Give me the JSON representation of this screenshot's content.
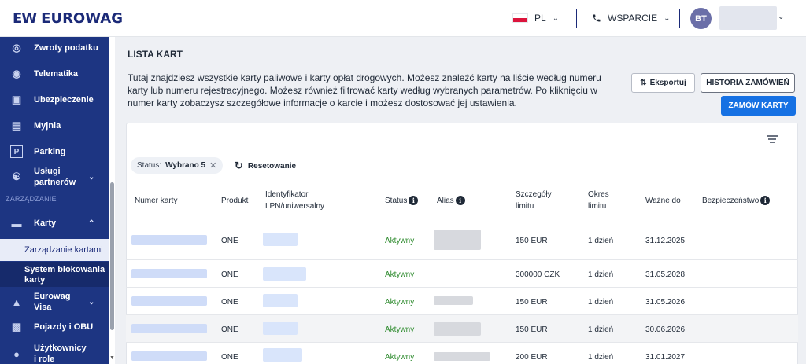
{
  "header": {
    "logo_mark": "EW",
    "logo_text": "EUROWAG",
    "language": "PL",
    "support_label": "WSPARCIE",
    "user_initials": "BT"
  },
  "sidebar": {
    "items": [
      {
        "label": "Zwroty podatku",
        "icon": "tax-refund-icon"
      },
      {
        "label": "Telematika",
        "icon": "telematics-icon"
      },
      {
        "label": "Ubezpieczenie",
        "icon": "insurance-icon"
      },
      {
        "label": "Myjnia",
        "icon": "carwash-icon"
      },
      {
        "label": "Parking",
        "icon": "parking-icon"
      },
      {
        "label": "Usługi partnerów",
        "icon": "partners-icon"
      }
    ],
    "section_label": "ZARZĄDZANIE",
    "karty_label": "Karty",
    "sub_active": "Zarządzanie kartami",
    "sub_item": "System blokowania karty",
    "more_items": [
      {
        "label": "Eurowag Visa",
        "icon": "visa-icon"
      },
      {
        "label": "Pojazdy i OBU",
        "icon": "vehicle-icon"
      },
      {
        "label": "Użytkownicy i role",
        "icon": "users-icon"
      }
    ]
  },
  "main": {
    "title": "LISTA KART",
    "description": "Tutaj znajdziesz wszystkie karty paliwowe i karty opłat drogowych. Możesz znaleźć karty na liście według numeru karty lub numeru rejestracyjnego. Możesz również filtrować karty według wybranych parametrów. Po kliknięciu w numer karty zobaczysz szczegółowe informacje o karcie i możesz dostosować jej ustawienia.",
    "export_label": "Eksportuj",
    "history_label": "HISTORIA ZAMÓWIEŃ",
    "order_label": "ZAMÓW KARTY",
    "filter_chip_prefix": "Status:",
    "filter_chip_value": "Wybrano 5",
    "reset_label": "Resetowanie"
  },
  "table": {
    "columns": {
      "card_number": "Numer karty",
      "product": "Produkt",
      "identifier": "Identyfikator LPN/uniwersalny",
      "status": "Status",
      "alias": "Alias",
      "limit_details": "Szczegóły limitu",
      "limit_period": "Okres limitu",
      "valid_to": "Ważne do",
      "security": "Bezpieczeństwo"
    },
    "rows": [
      {
        "product": "ONE",
        "status": "Aktywny",
        "limit": "150 EUR",
        "period": "1 dzień",
        "valid": "31.12.2025"
      },
      {
        "product": "ONE",
        "status": "Aktywny",
        "limit": "300000 CZK",
        "period": "1 dzień",
        "valid": "31.05.2028"
      },
      {
        "product": "ONE",
        "status": "Aktywny",
        "limit": "150 EUR",
        "period": "1 dzień",
        "valid": "31.05.2026"
      },
      {
        "product": "ONE",
        "status": "Aktywny",
        "limit": "150 EUR",
        "period": "1 dzień",
        "valid": "30.06.2026"
      },
      {
        "product": "ONE",
        "status": "Aktywny",
        "limit": "200 EUR",
        "period": "1 dzień",
        "valid": "31.01.2027"
      }
    ]
  },
  "colors": {
    "sidebar": "#1d3582",
    "primary_button": "#1671e3",
    "status_active": "#2e8b2e"
  }
}
